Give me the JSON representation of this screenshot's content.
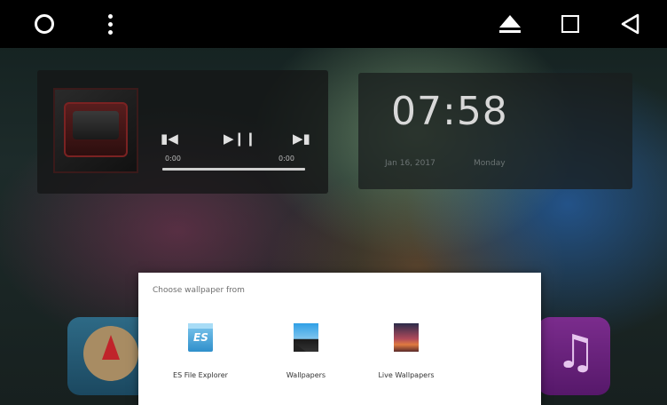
{
  "status_bar": {
    "icons": [
      "circle-icon",
      "overflow-menu-icon",
      "eject-icon",
      "recents-icon",
      "back-icon"
    ]
  },
  "music_widget": {
    "time_start": "0:00",
    "time_end": "0:00",
    "progress_fraction": 0
  },
  "clock_widget": {
    "time": "07:58",
    "date": "Jan 16, 2017",
    "day": "Monday"
  },
  "wallpaper_dialog": {
    "title": "Choose wallpaper from",
    "options": [
      {
        "label": "ES File Explorer",
        "icon": "es-file-explorer-icon"
      },
      {
        "label": "Wallpapers",
        "icon": "wallpapers-icon"
      },
      {
        "label": "Live Wallpapers",
        "icon": "live-wallpapers-icon"
      }
    ]
  },
  "home_apps": [
    "compass-app-icon",
    "music-app-icon"
  ]
}
